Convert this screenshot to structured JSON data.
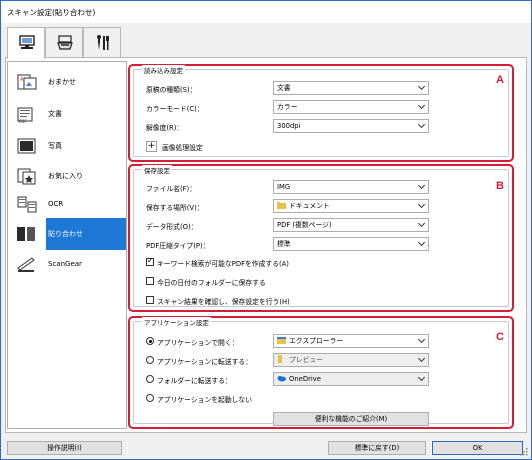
{
  "window": {
    "title": "スキャン設定(貼り合わせ)"
  },
  "tabs": [
    {
      "name": "scan-from-computer",
      "icon": "computer-scan-icon",
      "active": true
    },
    {
      "name": "scan-from-operation-panel",
      "icon": "scanner-panel-icon",
      "active": false
    },
    {
      "name": "general-settings",
      "icon": "tools-icon",
      "active": false
    }
  ],
  "sidebar": {
    "items": [
      {
        "label": "おまかせ",
        "icon": "auto-scan-icon",
        "selected": false
      },
      {
        "label": "文書",
        "icon": "document-icon",
        "selected": false
      },
      {
        "label": "写真",
        "icon": "photo-icon",
        "selected": false
      },
      {
        "label": "お気に入り",
        "icon": "favorite-icon",
        "selected": false
      },
      {
        "label": "OCR",
        "icon": "ocr-icon",
        "selected": false
      },
      {
        "label": "貼り合わせ",
        "icon": "stitch-icon",
        "selected": true
      },
      {
        "label": "ScanGear",
        "icon": "scangear-icon",
        "selected": false
      }
    ]
  },
  "scan_options": {
    "title": "読み込み設定",
    "letter": "A",
    "document_type": {
      "label": "原稿の種類(S)：",
      "value": "文書"
    },
    "color_mode": {
      "label": "カラーモード(C)：",
      "value": "カラー"
    },
    "resolution": {
      "label": "解像度(R)：",
      "value": "300dpi"
    },
    "image_processing": {
      "label": "画像処理設定"
    }
  },
  "save_settings": {
    "title": "保存設定",
    "letter": "B",
    "file_name": {
      "label": "ファイル名(F)：",
      "value": "IMG"
    },
    "save_in": {
      "label": "保存する場所(V)：",
      "value": "ドキュメント"
    },
    "data_format": {
      "label": "データ形式(O)：",
      "value": "PDF (複数ページ)"
    },
    "pdf_compression": {
      "label": "PDF圧縮タイプ(P)：",
      "value": "標準"
    },
    "checkbox_keyword": {
      "label": "キーワード検索が可能なPDFを作成する(A)",
      "checked": true
    },
    "checkbox_date_folder": {
      "label": "今日の日付のフォルダーに保存する",
      "checked": false
    },
    "checkbox_confirm": {
      "label": "スキャン結果を確認し、保存設定を行う(H)",
      "checked": false
    }
  },
  "app_settings": {
    "title": "アプリケーション設定",
    "letter": "C",
    "open_with": {
      "label": "アプリケーションで開く：",
      "value": "エクスプローラー",
      "selected": true
    },
    "send_to_app": {
      "label": "アプリケーションに転送する：",
      "value": "プレビュー",
      "selected": false
    },
    "send_to_folder": {
      "label": "フォルダーに転送する：",
      "value": "OneDrive",
      "selected": false
    },
    "do_not_start": {
      "label": "アプリケーションを起動しない",
      "selected": false
    },
    "more_functions_button": "便利な機能のご紹介(M)"
  },
  "footer": {
    "instructions_button": "操作説明(I)",
    "defaults_button": "標準に戻す(D)",
    "ok_button": "OK"
  },
  "colors": {
    "accent": "#1e78d6",
    "highlight_border": "#d61c37",
    "window_border": "#2b6cc4"
  }
}
